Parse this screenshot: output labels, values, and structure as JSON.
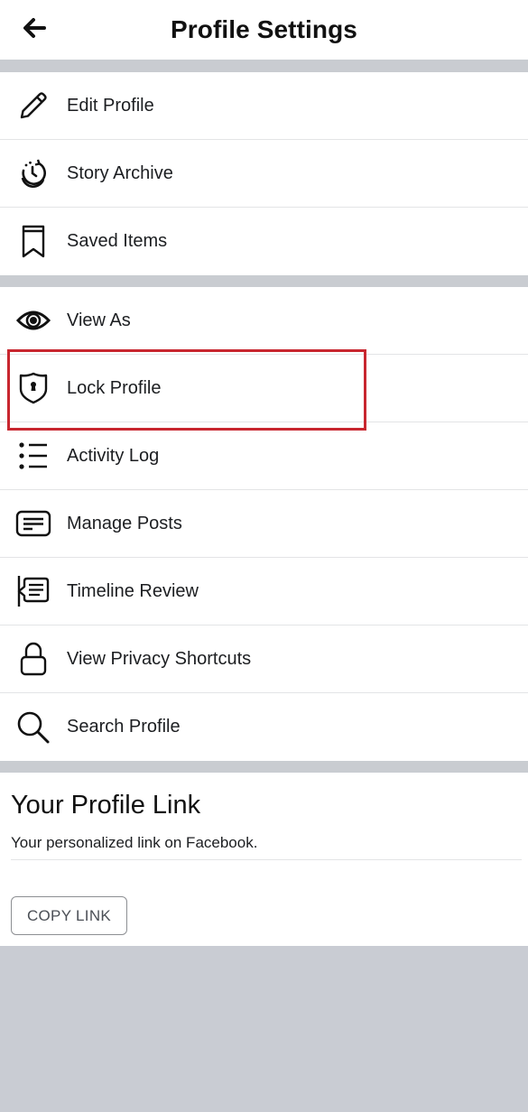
{
  "header": {
    "title": "Profile Settings",
    "back_icon": "arrow-left-icon"
  },
  "groups": [
    {
      "items": [
        {
          "label": "Edit Profile",
          "icon": "pencil-icon"
        },
        {
          "label": "Story Archive",
          "icon": "clock-history-icon"
        },
        {
          "label": "Saved Items",
          "icon": "bookmark-icon"
        }
      ]
    },
    {
      "items": [
        {
          "label": "View As",
          "icon": "eye-icon"
        },
        {
          "label": "Lock Profile",
          "icon": "shield-lock-icon",
          "highlighted": true
        },
        {
          "label": "Activity Log",
          "icon": "list-icon"
        },
        {
          "label": "Manage Posts",
          "icon": "posts-icon"
        },
        {
          "label": "Timeline Review",
          "icon": "timeline-review-icon"
        },
        {
          "label": "View Privacy Shortcuts",
          "icon": "lock-icon"
        },
        {
          "label": "Search Profile",
          "icon": "search-icon"
        }
      ]
    }
  ],
  "profile_link": {
    "title": "Your Profile Link",
    "description": "Your personalized link on Facebook.",
    "copy_button_label": "COPY LINK"
  },
  "colors": {
    "highlight_border": "#c8262f",
    "separator_band": "#c9ccd1",
    "text": "#1c1e21"
  }
}
